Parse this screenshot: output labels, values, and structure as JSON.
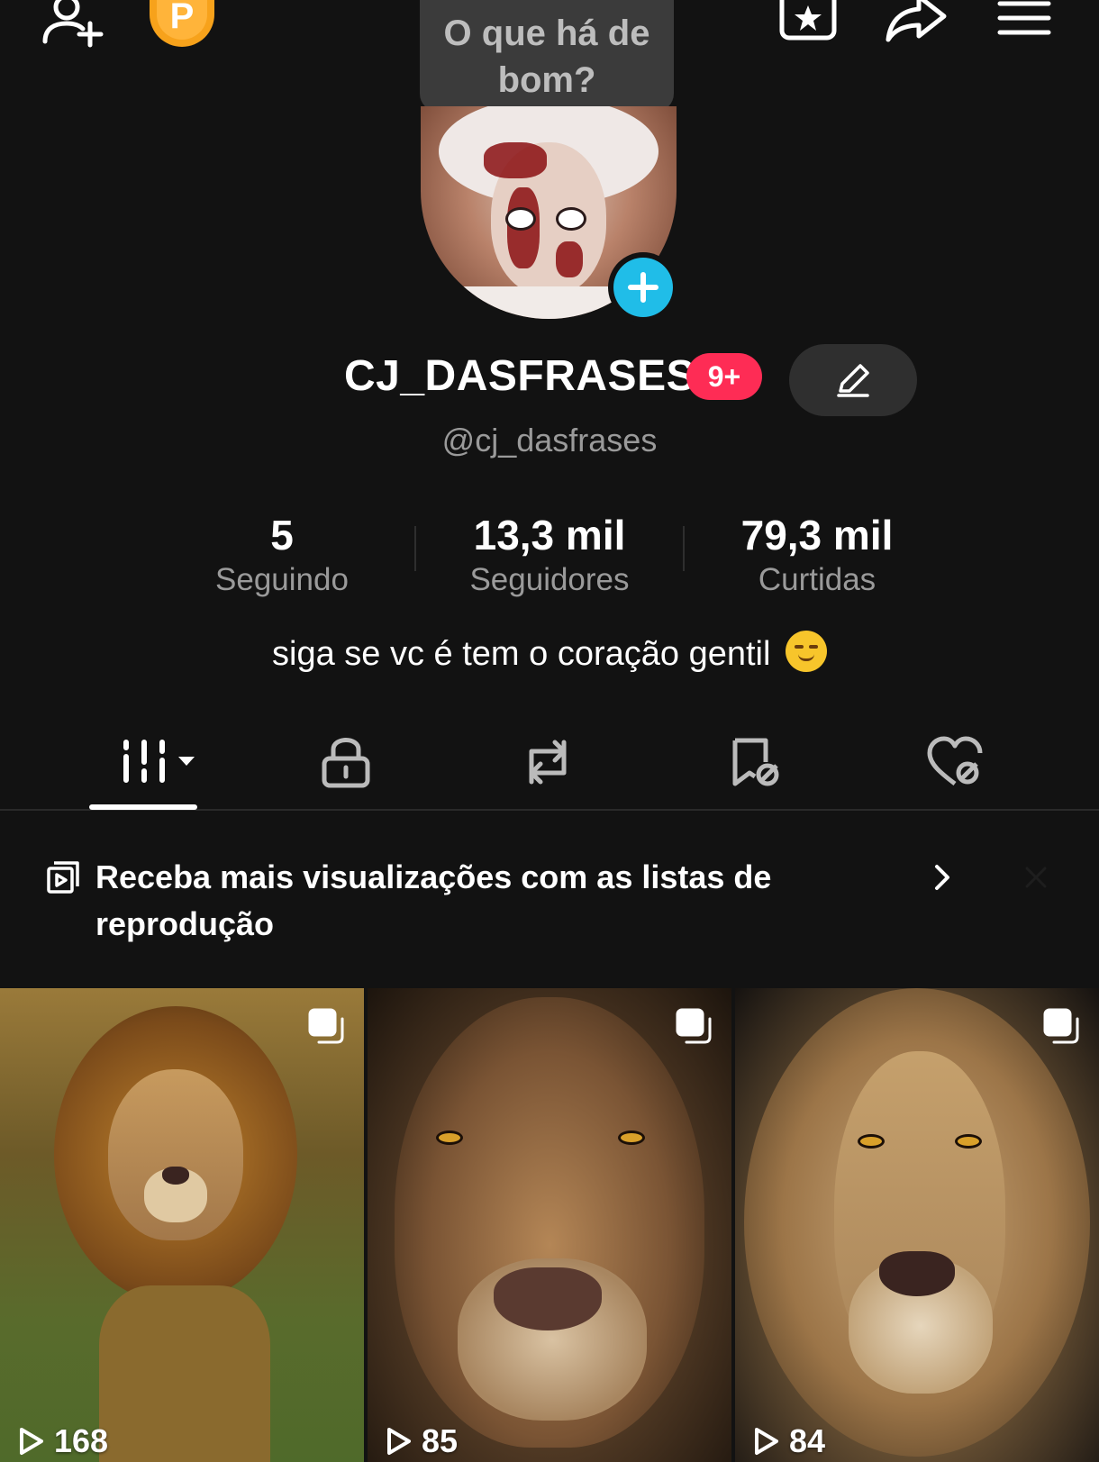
{
  "top_bar": {
    "coin_label": "P",
    "story_prompt": "O que há de bom?"
  },
  "profile": {
    "display_name": "CJ_DASFRASES",
    "notification_badge": "9+",
    "handle": "@cj_dasfrases",
    "bio": "siga se vc é tem o coração gentil"
  },
  "stats": [
    {
      "value": "5",
      "label": "Seguindo"
    },
    {
      "value": "13,3 mil",
      "label": "Seguidores"
    },
    {
      "value": "79,3 mil",
      "label": "Curtidas"
    }
  ],
  "tabs": [
    "videos-icon",
    "lock-icon",
    "repost-icon",
    "favorites-hidden-icon",
    "liked-hidden-icon"
  ],
  "banner": {
    "text": "Receba mais visualizações com as listas de reprodução"
  },
  "videos": [
    {
      "views": "168"
    },
    {
      "views": "85"
    },
    {
      "views": "84"
    }
  ],
  "colors": {
    "background": "#121212",
    "accent_red": "#fe2c55",
    "accent_cyan": "#20bde8",
    "coin": "#f7a21b"
  }
}
